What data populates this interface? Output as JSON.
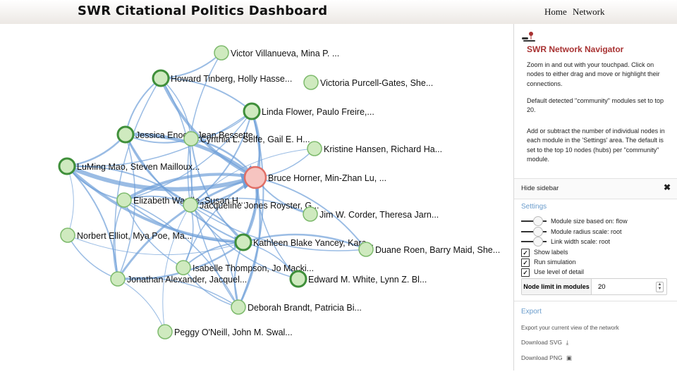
{
  "header": {
    "title": "SWR Citational Politics Dashboard",
    "nav": [
      "Home",
      "Network"
    ]
  },
  "graph": {
    "nodes": [
      {
        "label": "Victor Villanueva, Mina P. ...",
        "type": "light"
      },
      {
        "label": "Howard Tinberg, Holly Hasse...",
        "type": "dark"
      },
      {
        "label": "Victoria Purcell-Gates, She...",
        "type": "light"
      },
      {
        "label": "Linda Flower, Paulo Freire,...",
        "type": "dark"
      },
      {
        "label": "Jessica Enoch, Jean Bessette...",
        "type": "dark"
      },
      {
        "label": "Cynthia L. Selfe, Gail E. H...",
        "type": "light"
      },
      {
        "label": "Kristine Hansen, Richard Ha...",
        "type": "light"
      },
      {
        "label": "LuMing Mao, Steven Mailloux...",
        "type": "dark"
      },
      {
        "label": "Bruce Horner, Min-Zhan Lu, ...",
        "type": "red"
      },
      {
        "label": "Elizabeth Wardle, Susan H...",
        "type": "light"
      },
      {
        "label": "Jacqueline Jones Royster, G...",
        "type": "light"
      },
      {
        "label": "Jim W. Corder, Theresa Jarn...",
        "type": "light"
      },
      {
        "label": "Norbert Elliot, Mya Poe, Ma...",
        "type": "light"
      },
      {
        "label": "Kathleen Blake Yancey, Kara...",
        "type": "dark"
      },
      {
        "label": "Duane Roen, Barry Maid, She...",
        "type": "light"
      },
      {
        "label": "Isabelle Thompson, Jo Macki...",
        "type": "light"
      },
      {
        "label": "Jonathan Alexander, Jacquel...",
        "type": "light"
      },
      {
        "label": "Edward M. White, Lynn Z. Bl...",
        "type": "dark"
      },
      {
        "label": "Deborah Brandt, Patricia Bi...",
        "type": "light"
      },
      {
        "label": "Peggy O'Neill, John M. Swal...",
        "type": "light"
      }
    ]
  },
  "sidebar": {
    "title": "SWR Network Navigator",
    "info": [
      "Zoom in and out with your touchpad. Click on nodes to either drag and move or highlight their connections.",
      "Default detected \"community\" modules set to top 20.",
      "Add or subtract the number of individual nodes in each module in the 'Settings' area. The default is set to the top 10 nodes (hubs) per \"community\" module."
    ],
    "hide_label": "Hide sidebar",
    "settings_heading": "Settings",
    "sliders": [
      "Module size based on: flow",
      "Module radius scale: root",
      "Link width scale: root"
    ],
    "checkboxes": [
      "Show labels",
      "Run simulation",
      "Use level of detail"
    ],
    "node_limit_label": "Node limit in modules",
    "node_limit_value": "20",
    "export_heading": "Export",
    "export_desc": "Export your current view of the network",
    "download_svg": "Download SVG",
    "download_png": "Download PNG"
  },
  "colors": {
    "accent": "#a83232",
    "settings": "#6a9ccc",
    "edge": "#6f9fd8",
    "node_light": "#cfeabf",
    "node_border": "#7dba6c",
    "node_dark_border": "#3f8f3a",
    "node_red": "#f6c4c0",
    "node_red_border": "#e06e66"
  }
}
